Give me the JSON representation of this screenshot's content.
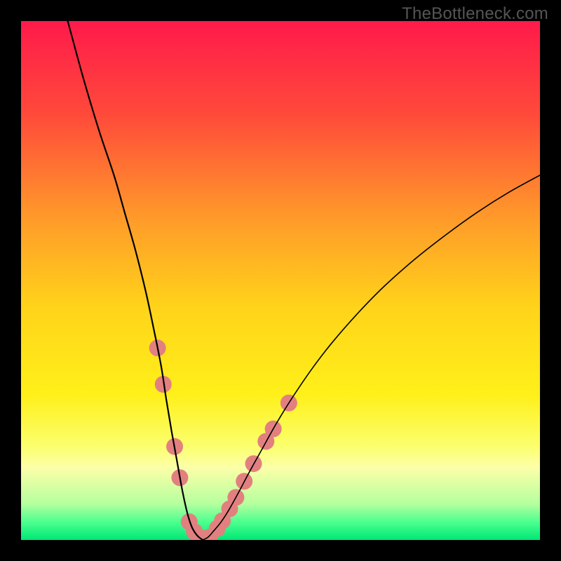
{
  "watermark": "TheBottleneck.com",
  "chart_data": {
    "type": "line",
    "title": "",
    "xlabel": "",
    "ylabel": "",
    "xlim": [
      0,
      100
    ],
    "ylim": [
      0,
      100
    ],
    "background": {
      "type": "vertical-gradient",
      "stops": [
        {
          "offset": 0.0,
          "color": "#ff1a4b"
        },
        {
          "offset": 0.18,
          "color": "#ff4a3a"
        },
        {
          "offset": 0.38,
          "color": "#ff9a2a"
        },
        {
          "offset": 0.55,
          "color": "#ffd31a"
        },
        {
          "offset": 0.72,
          "color": "#fff01a"
        },
        {
          "offset": 0.82,
          "color": "#fbff6e"
        },
        {
          "offset": 0.86,
          "color": "#fcffa8"
        },
        {
          "offset": 0.93,
          "color": "#b6ff9e"
        },
        {
          "offset": 0.965,
          "color": "#4dff8f"
        },
        {
          "offset": 1.0,
          "color": "#00e876"
        }
      ]
    },
    "series": [
      {
        "name": "left-curve",
        "color": "#000000",
        "x": [
          9,
          12,
          15,
          18,
          20,
          22,
          24,
          25.5,
          27,
          28,
          29,
          30,
          30.8,
          31.5,
          32.2,
          33,
          34,
          35
        ],
        "y": [
          100,
          89,
          79,
          70,
          63,
          56,
          48,
          41,
          33.5,
          27,
          21,
          15.5,
          11,
          7.5,
          4.6,
          2.3,
          0.8,
          0
        ]
      },
      {
        "name": "right-curve",
        "color": "#000000",
        "x": [
          35,
          36,
          37,
          38.5,
          40,
          42,
          44,
          46.5,
          49,
          52,
          56,
          60,
          65,
          70,
          76,
          82,
          88,
          94,
          100
        ],
        "y": [
          0,
          0.5,
          1.6,
          3.4,
          5.7,
          9.3,
          13.1,
          17.6,
          22.1,
          27.0,
          32.9,
          38.1,
          43.8,
          48.9,
          54.2,
          58.9,
          63.2,
          67.0,
          70.3
        ]
      }
    ],
    "markers": {
      "name": "highlighted-points",
      "color": "#e28080",
      "radius": 12,
      "points": [
        {
          "x": 26.3,
          "y": 37.0
        },
        {
          "x": 27.4,
          "y": 30.0
        },
        {
          "x": 29.6,
          "y": 18.0
        },
        {
          "x": 30.6,
          "y": 12.0
        },
        {
          "x": 32.4,
          "y": 3.5
        },
        {
          "x": 33.4,
          "y": 1.6
        },
        {
          "x": 35.0,
          "y": 0.3
        },
        {
          "x": 36.3,
          "y": 0.5
        },
        {
          "x": 37.8,
          "y": 2.2
        },
        {
          "x": 38.8,
          "y": 3.7
        },
        {
          "x": 40.2,
          "y": 6.0
        },
        {
          "x": 41.4,
          "y": 8.2
        },
        {
          "x": 43.0,
          "y": 11.3
        },
        {
          "x": 44.8,
          "y": 14.7
        },
        {
          "x": 47.2,
          "y": 19.0
        },
        {
          "x": 48.6,
          "y": 21.4
        },
        {
          "x": 51.6,
          "y": 26.4
        }
      ]
    }
  }
}
